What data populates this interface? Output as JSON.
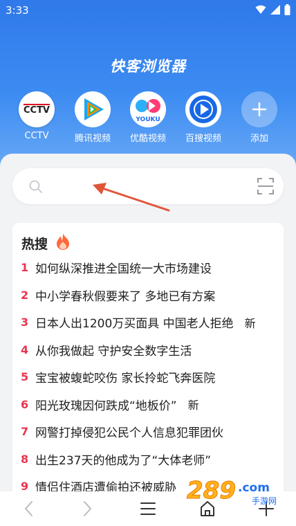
{
  "status_bar": {
    "time": "3:33"
  },
  "app_title": "快客浏览器",
  "shortcuts": [
    {
      "label": "CCTV",
      "icon": "cctv-logo",
      "logo_text": "CCTV"
    },
    {
      "label": "腾讯视频",
      "icon": "tencent-video-logo"
    },
    {
      "label": "优酷视频",
      "icon": "youku-logo",
      "logo_text": "YOUKU"
    },
    {
      "label": "百搜视频",
      "icon": "baisou-video-logo"
    },
    {
      "label": "添加",
      "icon": "plus-icon"
    }
  ],
  "search": {
    "placeholder": ""
  },
  "hot_search": {
    "title": "热搜",
    "items": [
      {
        "rank": "1",
        "text": "如何纵深推进全国统一大市场建设",
        "tag": ""
      },
      {
        "rank": "2",
        "text": "中小学春秋假要来了 多地已有方案",
        "tag": ""
      },
      {
        "rank": "3",
        "text": "日本人出1200万买面具 中国老人拒绝",
        "tag": "新"
      },
      {
        "rank": "4",
        "text": "从你我做起 守护安全数字生活",
        "tag": ""
      },
      {
        "rank": "5",
        "text": "宝宝被蝮蛇咬伤 家长拎蛇飞奔医院",
        "tag": ""
      },
      {
        "rank": "6",
        "text": "阳光玫瑰因何跌成“地板价”",
        "tag": "新"
      },
      {
        "rank": "7",
        "text": "网警打掉侵犯公民个人信息犯罪团伙",
        "tag": ""
      },
      {
        "rank": "8",
        "text": "出生237天的他成为了“大体老师”",
        "tag": ""
      },
      {
        "rank": "9",
        "text": "情侣住酒店遭偷拍还被威胁",
        "tag": ""
      }
    ]
  },
  "watermark": {
    "text": "289",
    "domain": ".com",
    "sub": "手游网"
  },
  "colors": {
    "primary": "#3a86f0",
    "rank": "#e8354f",
    "arrow": "#e0563a"
  }
}
